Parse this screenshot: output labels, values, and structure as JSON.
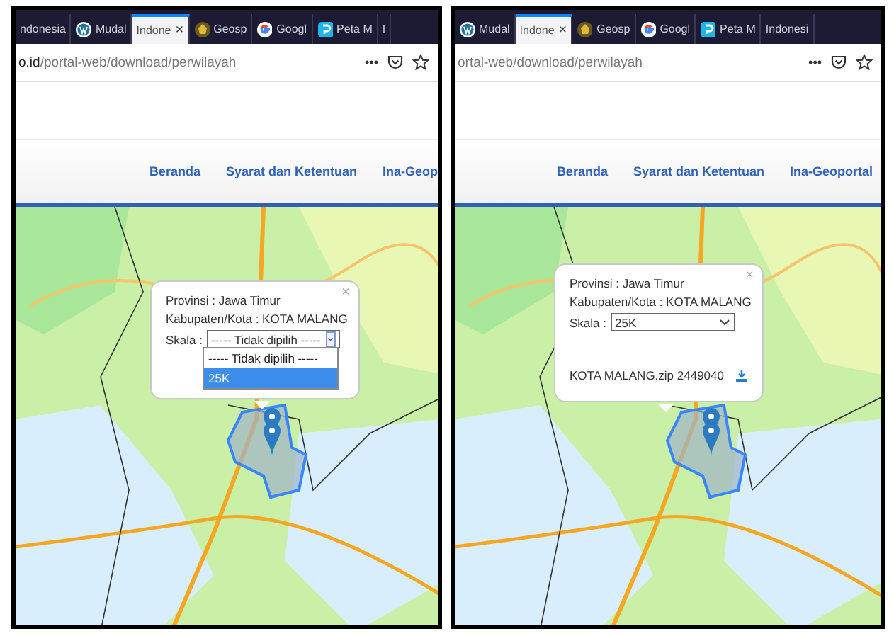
{
  "panels": [
    {
      "tabs": [
        {
          "label": "ndonesia",
          "kind": "plain",
          "selected": false
        },
        {
          "label": "Mudal",
          "kind": "wordpress",
          "selected": false
        },
        {
          "label": "Indone",
          "kind": "plain",
          "selected": true
        },
        {
          "label": "Geosp",
          "kind": "emblem",
          "selected": false
        },
        {
          "label": "Googl",
          "kind": "google",
          "selected": false
        },
        {
          "label": "Peta M",
          "kind": "peta",
          "selected": false
        },
        {
          "label": "I",
          "kind": "plain",
          "selected": false
        }
      ],
      "close_tab": "×",
      "url": {
        "host": "o.id",
        "path": "/portal-web/download/perwilayah"
      },
      "menu_dots": "•••",
      "nav": [
        "Beranda",
        "Syarat dan Ketentuan",
        "Ina-Geop"
      ],
      "popup": {
        "close": "×",
        "province": "Provinsi : Jawa Timur",
        "city": "Kabupaten/Kota : KOTA MALANG",
        "scale_label": "Skala :",
        "scale_value": "----- Tidak dipilih -----",
        "open": true,
        "options": [
          {
            "label": "----- Tidak dipilih -----",
            "selected": false
          },
          {
            "label": "25K",
            "selected": true
          }
        ]
      }
    },
    {
      "tabs": [
        {
          "label": "Mudal",
          "kind": "wordpress",
          "selected": false
        },
        {
          "label": "Indone",
          "kind": "plain",
          "selected": true
        },
        {
          "label": "Geosp",
          "kind": "emblem",
          "selected": false
        },
        {
          "label": "Googl",
          "kind": "google",
          "selected": false
        },
        {
          "label": "Peta M",
          "kind": "peta",
          "selected": false
        },
        {
          "label": "Indonesi",
          "kind": "plain",
          "selected": false
        }
      ],
      "close_tab": "×",
      "url": {
        "path": "ortal-web/download/perwilayah"
      },
      "menu_dots": "•••",
      "nav": [
        "Beranda",
        "Syarat dan Ketentuan",
        "Ina-Geoportal"
      ],
      "popup": {
        "close": "×",
        "province": "Provinsi : Jawa Timur",
        "city": "Kabupaten/Kota : KOTA MALANG",
        "scale_label": "Skala :",
        "scale_value": "25K",
        "open": false,
        "download": "KOTA MALANG.zip 2449040"
      }
    }
  ]
}
